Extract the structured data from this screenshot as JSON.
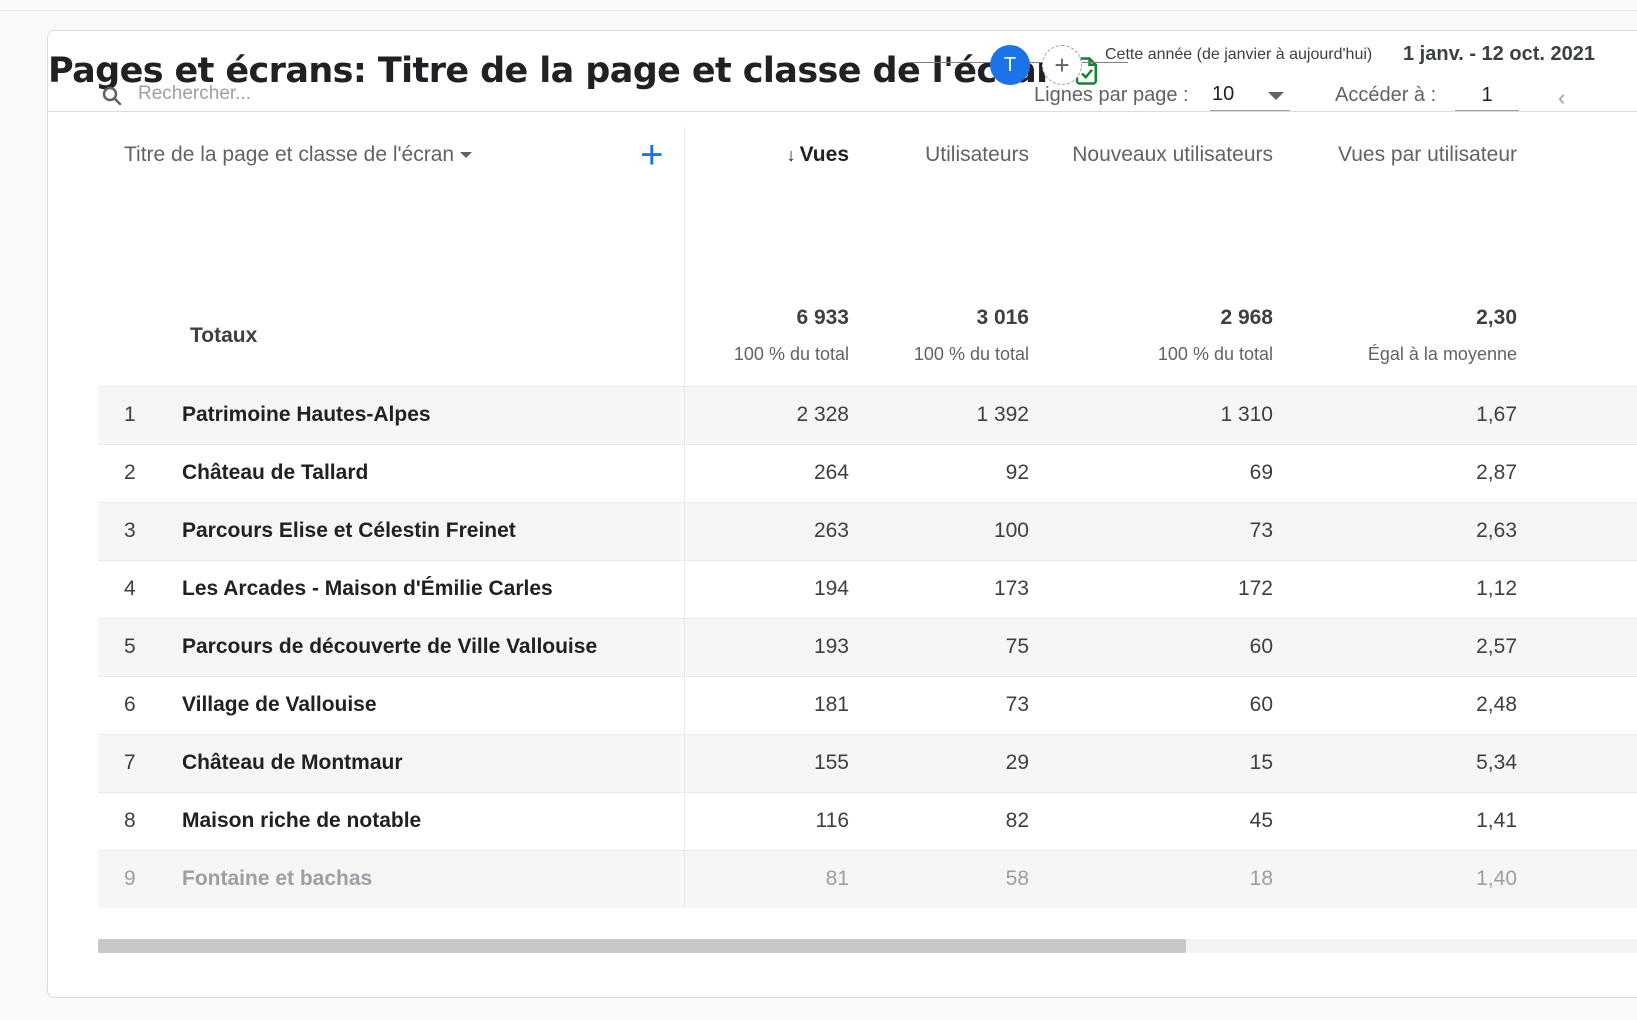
{
  "header": {
    "title": "Pages et écrans: Titre de la page et classe de l'écran",
    "avatar_letter": "T",
    "add_compare_symbol": "+",
    "date_label": "Cette année (de janvier à aujourd'hui)",
    "date_range": "1 janv. - 12 oct. 2021"
  },
  "toolbar": {
    "search_placeholder": "Rechercher...",
    "rows_per_page_label": "Lignes par page :",
    "rows_per_page_value": "10",
    "goto_label": "Accéder à :",
    "goto_value": "1"
  },
  "table": {
    "dimension_header": "Titre de la page et classe de l'écran",
    "columns": {
      "views": "Vues",
      "users": "Utilisateurs",
      "new_users": "Nouveaux utilisateurs",
      "views_per_user": "Vues par utilisateur"
    },
    "totals": {
      "label": "Totaux",
      "views": "6 933",
      "views_sub": "100 % du total",
      "users": "3 016",
      "users_sub": "100 % du total",
      "new_users": "2 968",
      "new_users_sub": "100 % du total",
      "views_per_user": "2,30",
      "views_per_user_sub": "Égal à la moyenne"
    },
    "rows": [
      {
        "idx": "1",
        "name": "Patrimoine Hautes-Alpes",
        "views": "2 328",
        "users": "1 392",
        "new_users": "1 310",
        "vpu": "1,67"
      },
      {
        "idx": "2",
        "name": "Château de Tallard",
        "views": "264",
        "users": "92",
        "new_users": "69",
        "vpu": "2,87"
      },
      {
        "idx": "3",
        "name": "Parcours Elise et Célestin Freinet",
        "views": "263",
        "users": "100",
        "new_users": "73",
        "vpu": "2,63"
      },
      {
        "idx": "4",
        "name": "Les Arcades - Maison d'Émilie Carles",
        "views": "194",
        "users": "173",
        "new_users": "172",
        "vpu": "1,12"
      },
      {
        "idx": "5",
        "name": "Parcours de découverte de Ville Vallouise",
        "views": "193",
        "users": "75",
        "new_users": "60",
        "vpu": "2,57"
      },
      {
        "idx": "6",
        "name": "Village de Vallouise",
        "views": "181",
        "users": "73",
        "new_users": "60",
        "vpu": "2,48"
      },
      {
        "idx": "7",
        "name": "Château de Montmaur",
        "views": "155",
        "users": "29",
        "new_users": "15",
        "vpu": "5,34"
      },
      {
        "idx": "8",
        "name": "Maison riche de notable",
        "views": "116",
        "users": "82",
        "new_users": "45",
        "vpu": "1,41"
      },
      {
        "idx": "9",
        "name": "Fontaine et bachas",
        "views": "81",
        "users": "58",
        "new_users": "18",
        "vpu": "1,40"
      }
    ]
  },
  "colors": {
    "accent": "#1a73e8",
    "success": "#188038"
  }
}
